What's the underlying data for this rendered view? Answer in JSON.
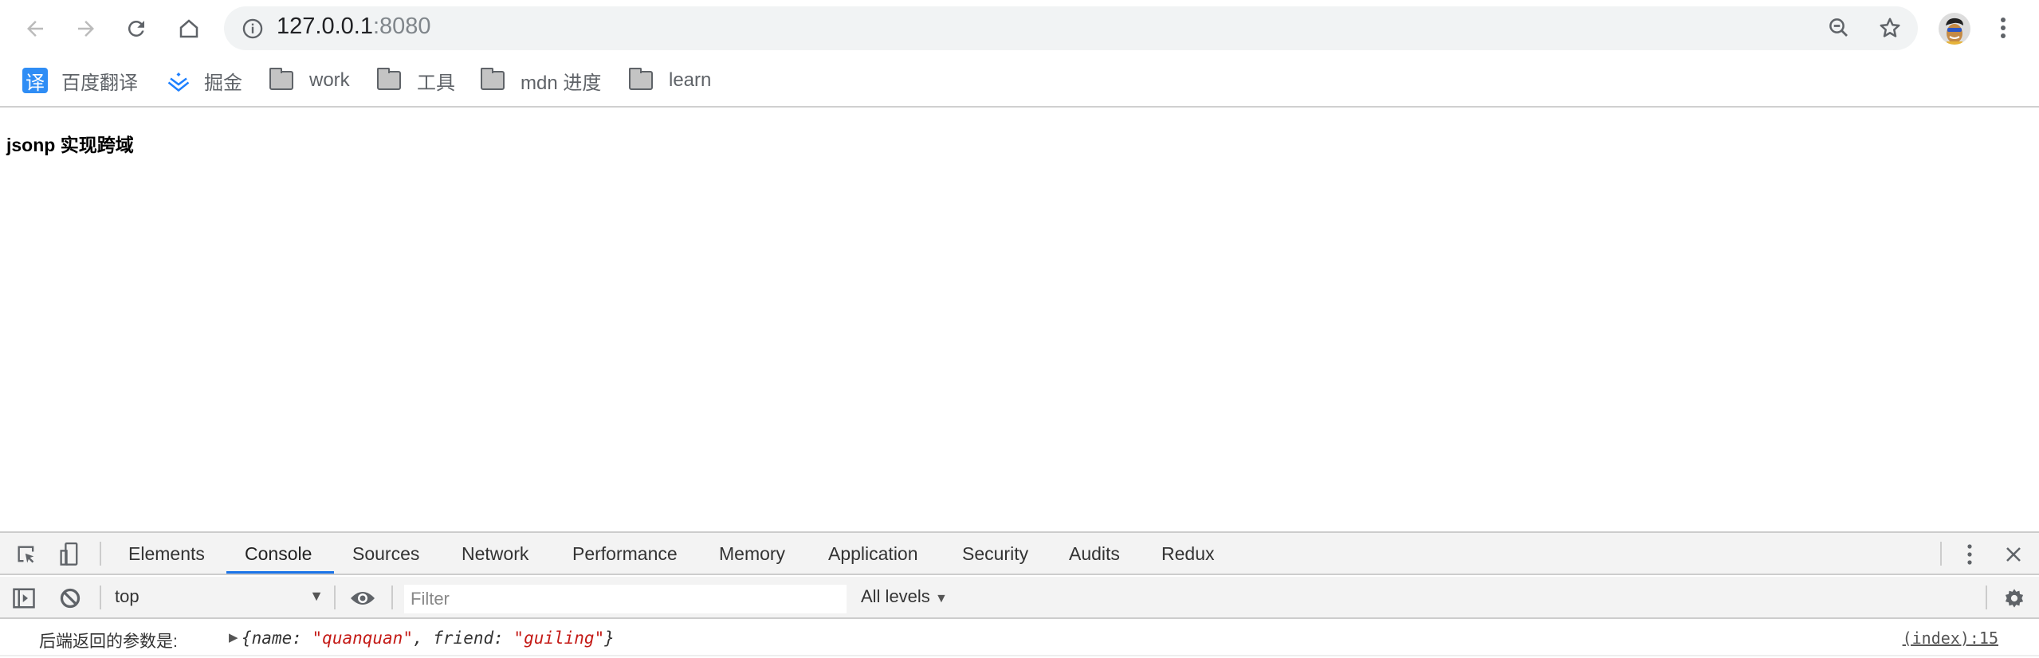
{
  "browser": {
    "url_host": "127.0.0.1",
    "url_port": ":8080",
    "bookmarks": [
      {
        "label": "百度翻译",
        "icon": "baidu-translate-icon",
        "icon_text": "译"
      },
      {
        "label": "掘金",
        "icon": "juejin-icon"
      },
      {
        "label": "work",
        "icon": "folder-icon"
      },
      {
        "label": "工具",
        "icon": "folder-icon"
      },
      {
        "label": "mdn 进度",
        "icon": "folder-icon"
      },
      {
        "label": "learn",
        "icon": "folder-icon"
      }
    ]
  },
  "page": {
    "heading": "jsonp 实现跨域"
  },
  "devtools": {
    "tabs": [
      "Elements",
      "Console",
      "Sources",
      "Network",
      "Performance",
      "Memory",
      "Application",
      "Security",
      "Audits",
      "Redux"
    ],
    "active_tab": "Console",
    "accent": "#1a73e8",
    "context": "top",
    "filter_placeholder": "Filter",
    "levels": "All levels",
    "console": {
      "label": "后端返回的参数是:",
      "open_brace": "{",
      "k1": "name",
      "v1": "\"quanquan\"",
      "comma": ", ",
      "k2": "friend",
      "v2": "\"guiling\"",
      "close_brace": "}",
      "source": "(index):15"
    }
  }
}
